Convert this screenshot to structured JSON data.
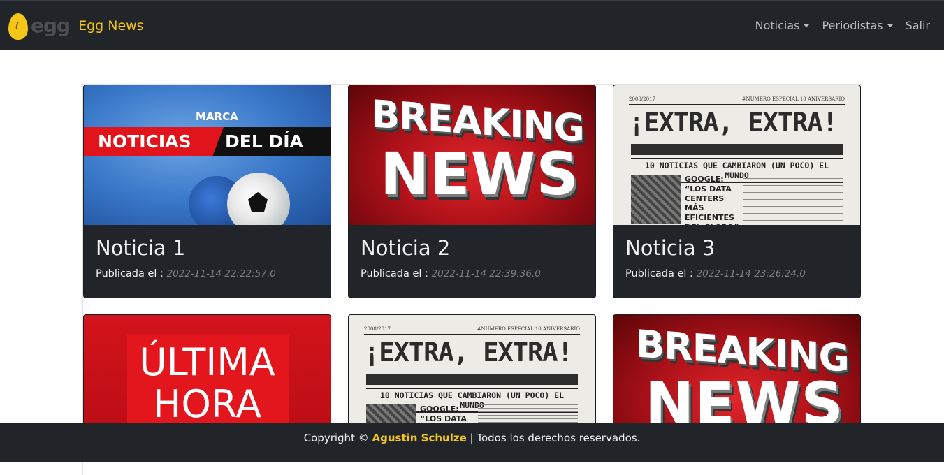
{
  "navbar": {
    "logo_text": "egg",
    "brand": "Egg News",
    "items": [
      {
        "label": "Noticias",
        "dropdown": true
      },
      {
        "label": "Periodistas",
        "dropdown": true
      },
      {
        "label": "Salir",
        "dropdown": false
      }
    ]
  },
  "cards": [
    {
      "title": "Noticia 1",
      "published_label": "Publicada el :",
      "date": "2022-11-14 22:22:57.0",
      "image": "marca-noticias-del-dia"
    },
    {
      "title": "Noticia 2",
      "published_label": "Publicada el :",
      "date": "2022-11-14 22:39:36.0",
      "image": "breaking-news"
    },
    {
      "title": "Noticia 3",
      "published_label": "Publicada el :",
      "date": "2022-11-14 23:26:24.0",
      "image": "extra-extra"
    },
    {
      "image": "ultima-hora"
    },
    {
      "image": "extra-extra"
    },
    {
      "image": "breaking-news"
    }
  ],
  "images": {
    "marca": {
      "logo": "MARCA",
      "red": "NOTICIAS",
      "black": "DEL DÍA"
    },
    "breaking": {
      "line1": "BREAKING",
      "line2": "NEWS"
    },
    "extra": {
      "top_left": "2008/2017",
      "top_right": "#NÚMERO ESPECIAL 10 ANIVERSARIO",
      "title": "¡EXTRA, EXTRA!",
      "headline": "10 NOTICIAS QUE CAMBIARON (UN POCO) EL MUNDO",
      "google": "GOOGLE:",
      "google_rest": "“LOS DATA CENTERS MÁS EFICIENTES DEL GLOBO”",
      "google_rest_short": "“LOS DATA"
    },
    "ultima": {
      "line1": "ÚLTIMA",
      "line2": "HORA"
    }
  },
  "footer": {
    "prefix": "Copyright ©",
    "author": "Agustin Schulze",
    "suffix": "| Todos los derechos reservados."
  },
  "colors": {
    "navbar_bg": "#212529",
    "accent": "#f5c518",
    "card_bg": "#212529"
  }
}
